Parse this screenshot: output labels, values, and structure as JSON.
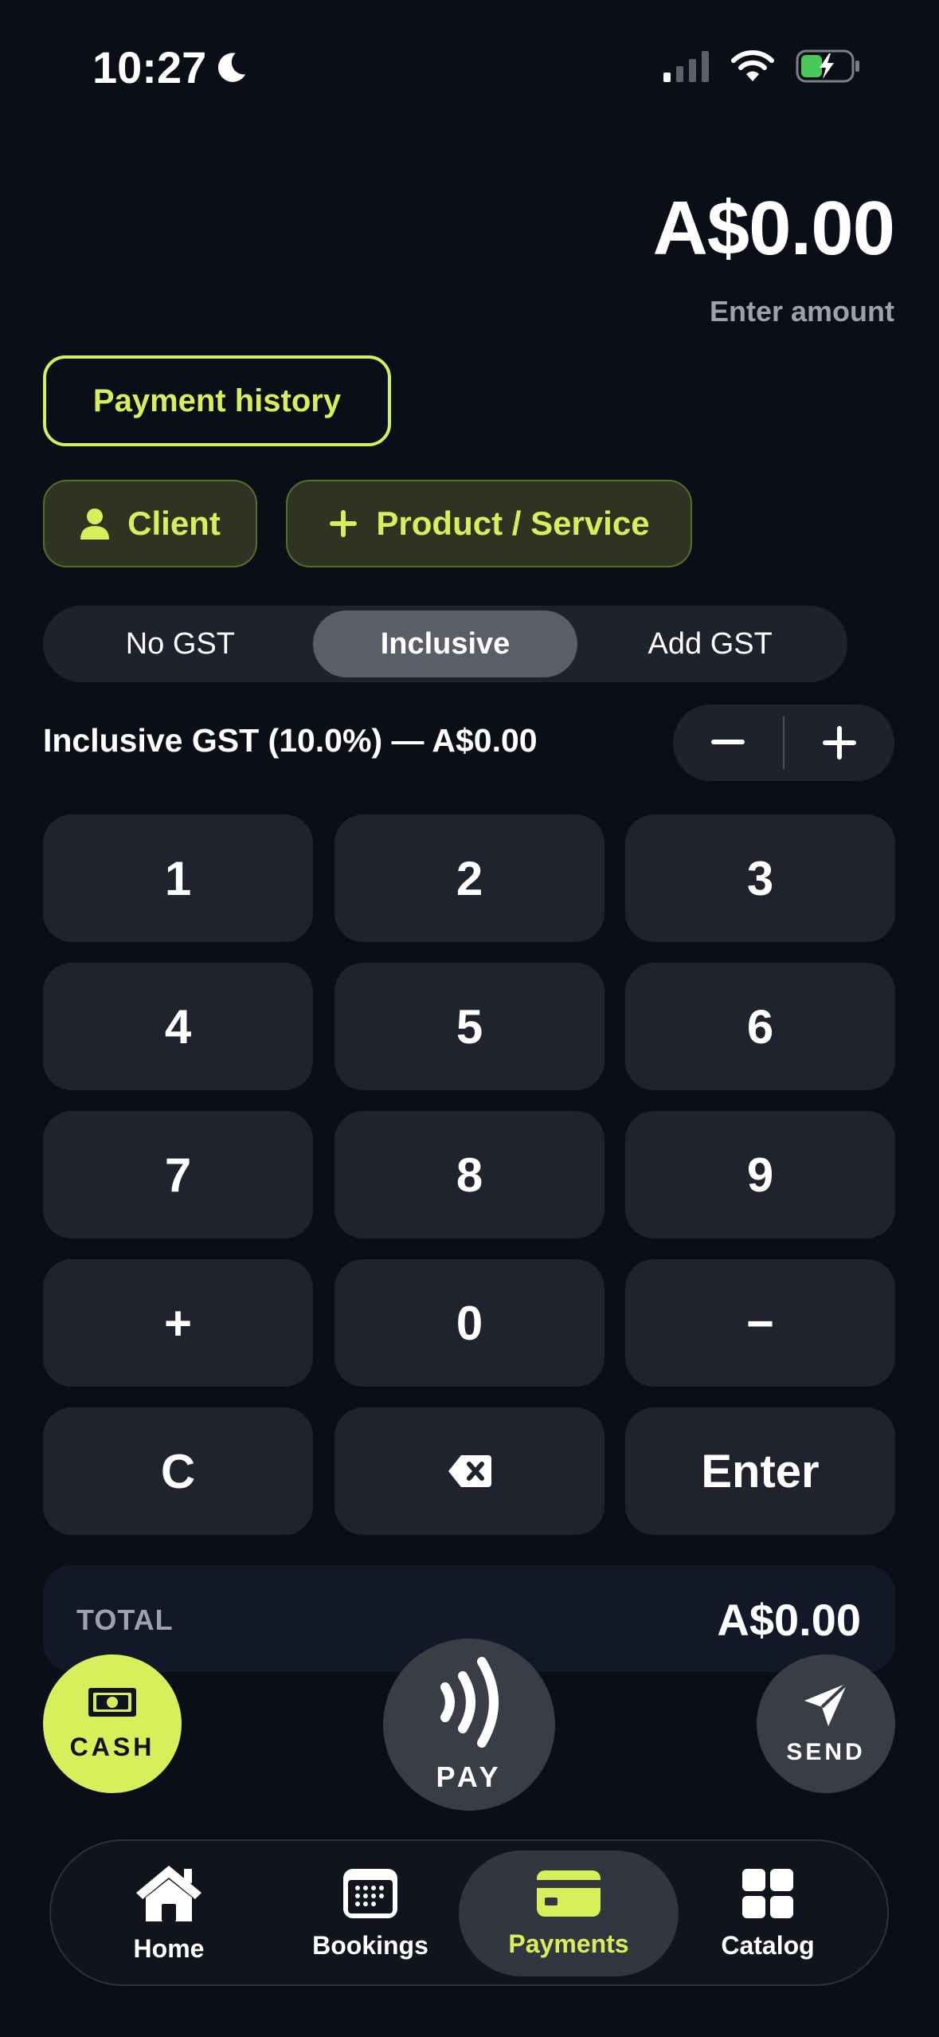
{
  "status_bar": {
    "time": "10:27"
  },
  "amount": {
    "value": "A$0.00",
    "hint": "Enter amount"
  },
  "history_button": {
    "label": "Payment history"
  },
  "chips": {
    "client": "Client",
    "product": "Product / Service"
  },
  "gst_modes": [
    {
      "label": "No GST"
    },
    {
      "label": "Inclusive"
    },
    {
      "label": "Add GST"
    }
  ],
  "gst_selected": "Inclusive",
  "gst_summary": "Inclusive GST (10.0%) — A$0.00",
  "stepper": {
    "minus": "−",
    "plus": "+"
  },
  "keypad": [
    "1",
    "2",
    "3",
    "4",
    "5",
    "6",
    "7",
    "8",
    "9",
    "+",
    "0",
    "−",
    "C",
    "backspace",
    "Enter"
  ],
  "total": {
    "label": "TOTAL",
    "value": "A$0.00"
  },
  "actions": {
    "cash": "CASH",
    "pay": "PAY",
    "send": "SEND"
  },
  "tabs": [
    {
      "label": "Home",
      "icon": "home-icon"
    },
    {
      "label": "Bookings",
      "icon": "calendar-icon"
    },
    {
      "label": "Payments",
      "icon": "card-icon"
    },
    {
      "label": "Catalog",
      "icon": "grid-icon"
    }
  ],
  "active_tab": "Payments",
  "colors": {
    "accent": "#d6ef5b",
    "background": "#0b0d17",
    "key": "#20222d"
  }
}
